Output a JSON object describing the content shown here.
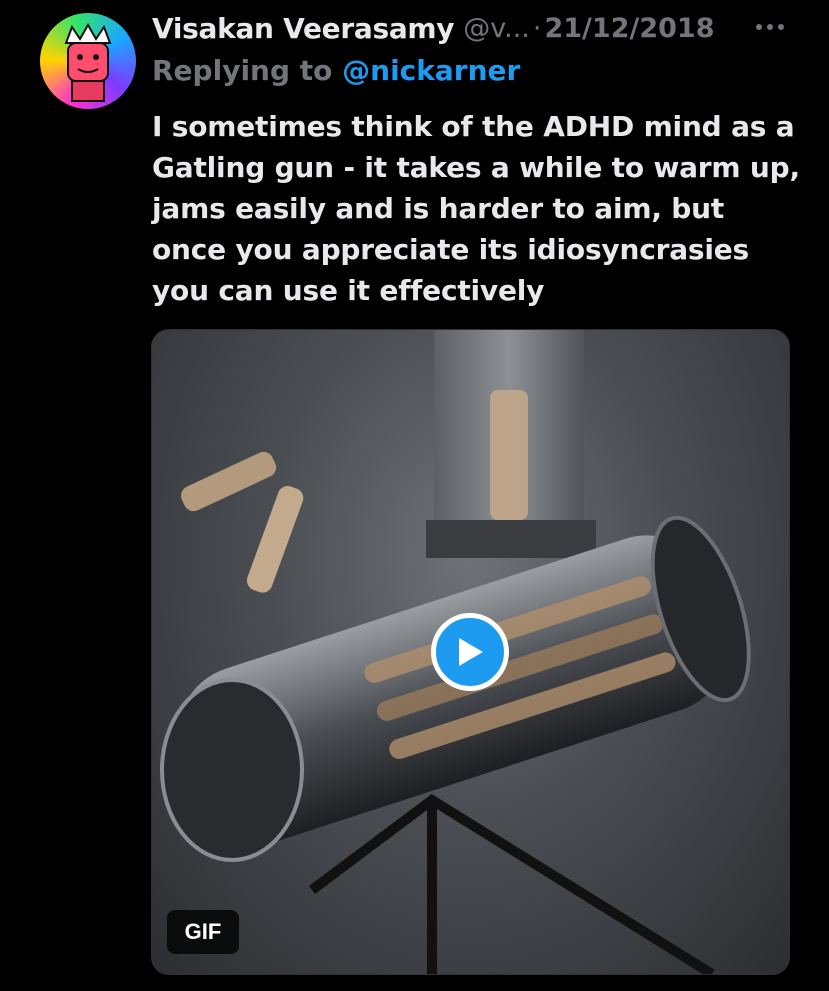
{
  "tweet": {
    "author": {
      "display_name": "Visakan Veerasamy",
      "handle": "@v...",
      "avatar_icon": "avatar-king-illustration"
    },
    "separator": "·",
    "date": "21/12/2018",
    "more_icon": "more-options-icon",
    "replying_to": {
      "prefix": "Replying to ",
      "mention": "@nickarner"
    },
    "text": "I sometimes think of the ADHD mind as a Gatling gun - it takes a while to warm up, jams easily and is harder to aim, but once you appreciate its idiosyncrasies you can use it effectively",
    "media": {
      "type": "gif",
      "badge": "GIF",
      "play_icon": "play-icon",
      "description_icon": "gatling-gun-image"
    }
  },
  "colors": {
    "background": "#000000",
    "primary_text": "#e7e9ea",
    "secondary_text": "#71767b",
    "accent": "#1d9bf0"
  }
}
